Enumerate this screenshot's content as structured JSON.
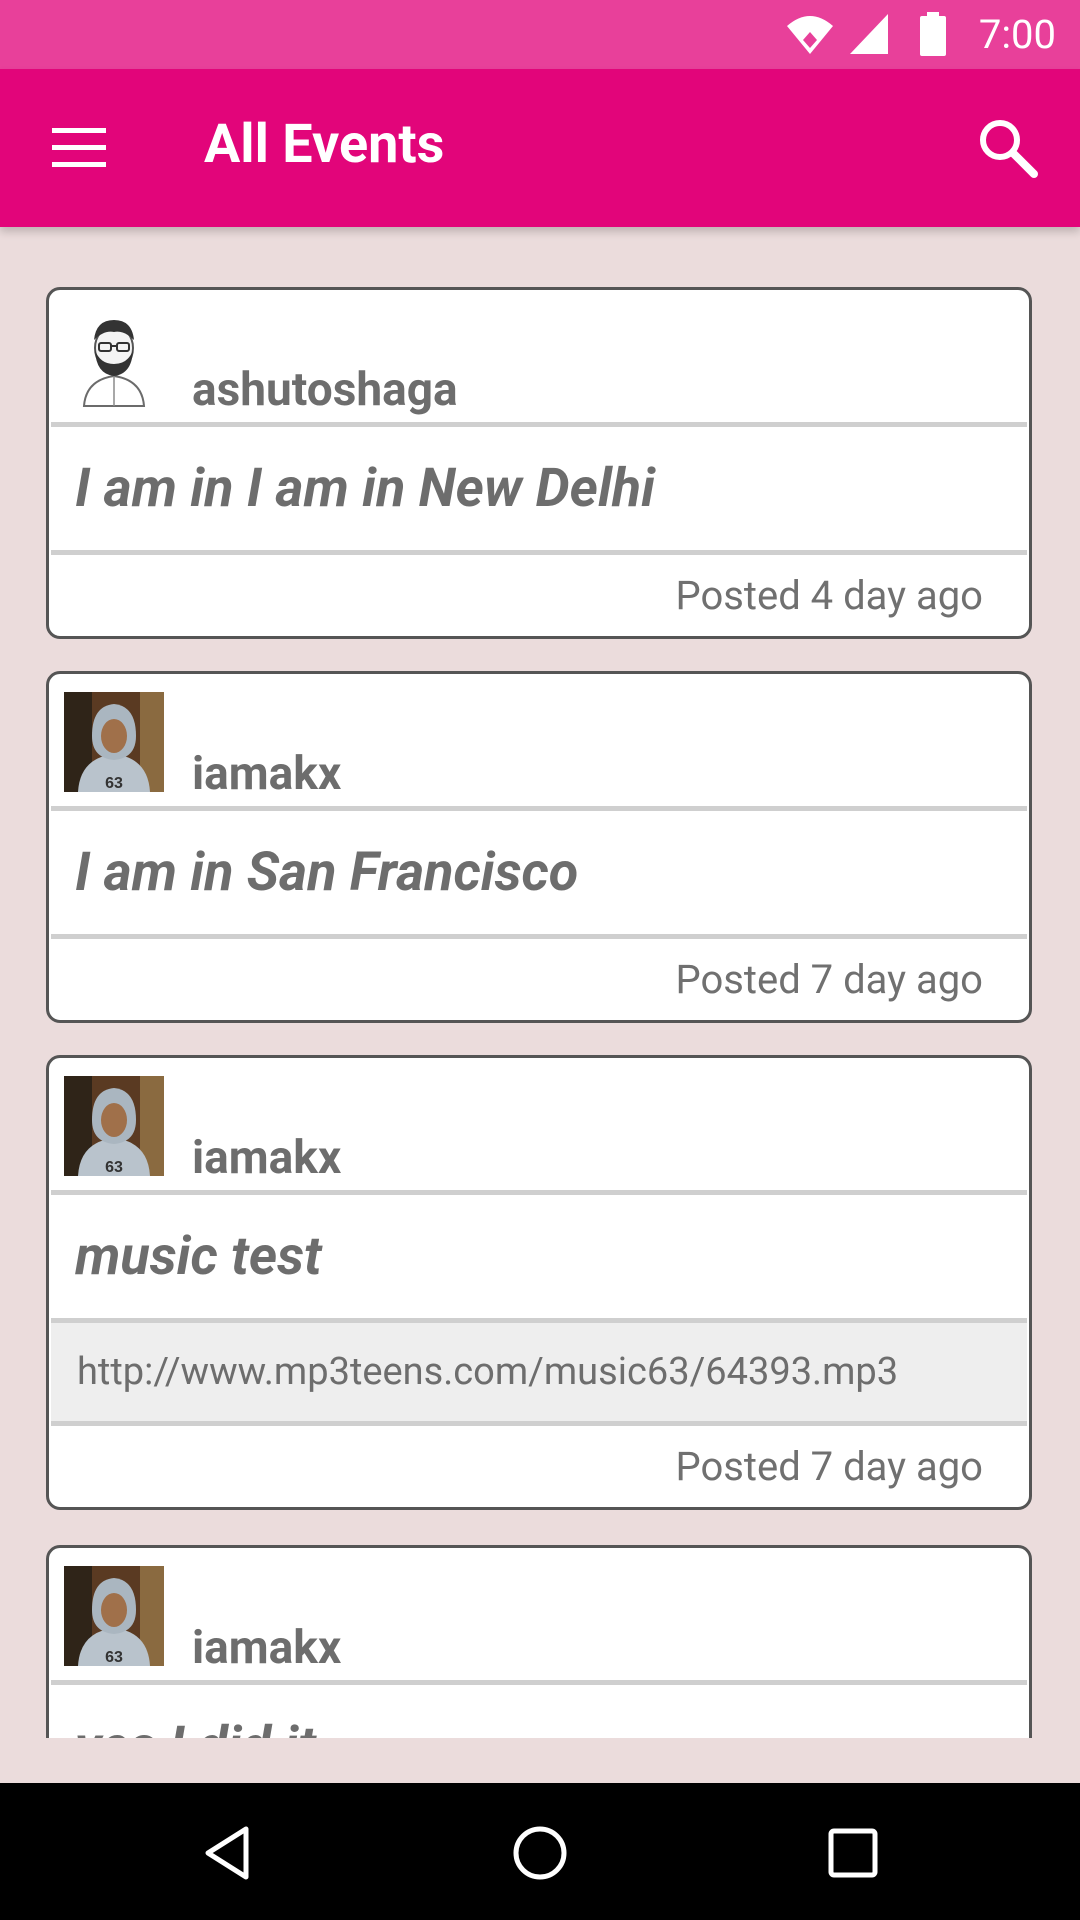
{
  "status_bar": {
    "time": "7:00"
  },
  "app_bar": {
    "title": "All Events",
    "menu_icon": "menu-icon",
    "search_icon": "search-icon"
  },
  "colors": {
    "status_bar": "#e8409a",
    "app_bar": "#e2057a",
    "background": "#ebdcdc",
    "text_gray": "#6d6d6d"
  },
  "events": [
    {
      "username": "ashutoshaga",
      "avatar": "bearded-man-avatar",
      "message": "I am in I am in New Delhi",
      "posted": "Posted 4 day ago"
    },
    {
      "username": "iamakx",
      "avatar": "hoodie-photo-avatar",
      "message": "I am in San Francisco",
      "posted": "Posted 7 day ago"
    },
    {
      "username": "iamakx",
      "avatar": "hoodie-photo-avatar",
      "message": "music test",
      "link": "http://www.mp3teens.com/music63/64393.mp3",
      "posted": "Posted 7 day ago"
    },
    {
      "username": "iamakx",
      "avatar": "hoodie-photo-avatar",
      "message": "yes I did it"
    }
  ],
  "nav_bar": {
    "back_icon": "back-triangle-icon",
    "home_icon": "home-circle-icon",
    "recents_icon": "recents-square-icon"
  }
}
